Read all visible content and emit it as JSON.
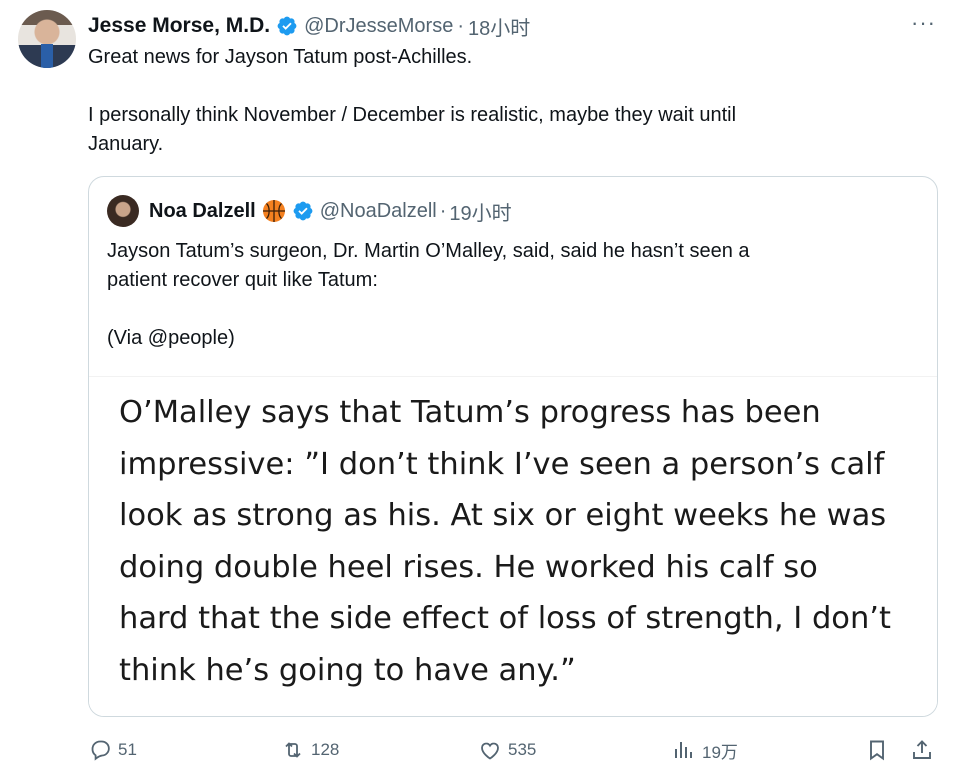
{
  "tweet": {
    "author_name": "Jesse Morse, M.D.",
    "handle": "@DrJesseMorse",
    "separator": "·",
    "time": "18小时",
    "more": "···",
    "lines": [
      "Great news for Jayson Tatum post-Achilles.",
      "I personally think November / December is realistic, maybe they wait until",
      "January."
    ]
  },
  "quote": {
    "author_name": "Noa Dalzell",
    "handle": "@NoaDalzell",
    "separator": "·",
    "time": "19小时",
    "lines": [
      "Jayson Tatum’s surgeon, Dr. Martin O’Malley, said, said he hasn’t seen a",
      "patient recover quit like Tatum:",
      "(Via @people)"
    ],
    "image_lines": [
      "O’Malley says that Tatum’s progress has been",
      "impressive: ”I don’t think I’ve seen a person’s calf",
      "look as strong as his. At six or eight weeks he was",
      "doing double heel rises. He worked his calf so",
      "hard that the side effect of loss of strength, I don’t",
      "think he’s going to have any.”"
    ]
  },
  "actions": {
    "replies": "51",
    "reposts": "128",
    "likes": "535",
    "views": "19万"
  },
  "colors": {
    "verified": "#1d9bf0",
    "muted": "#536471",
    "text": "#0f1419",
    "border": "#cfd9de"
  },
  "icons": [
    "verified-badge-icon",
    "more-icon",
    "basketball-icon",
    "reply-icon",
    "repost-icon",
    "like-icon",
    "views-icon",
    "bookmark-icon",
    "share-icon"
  ]
}
